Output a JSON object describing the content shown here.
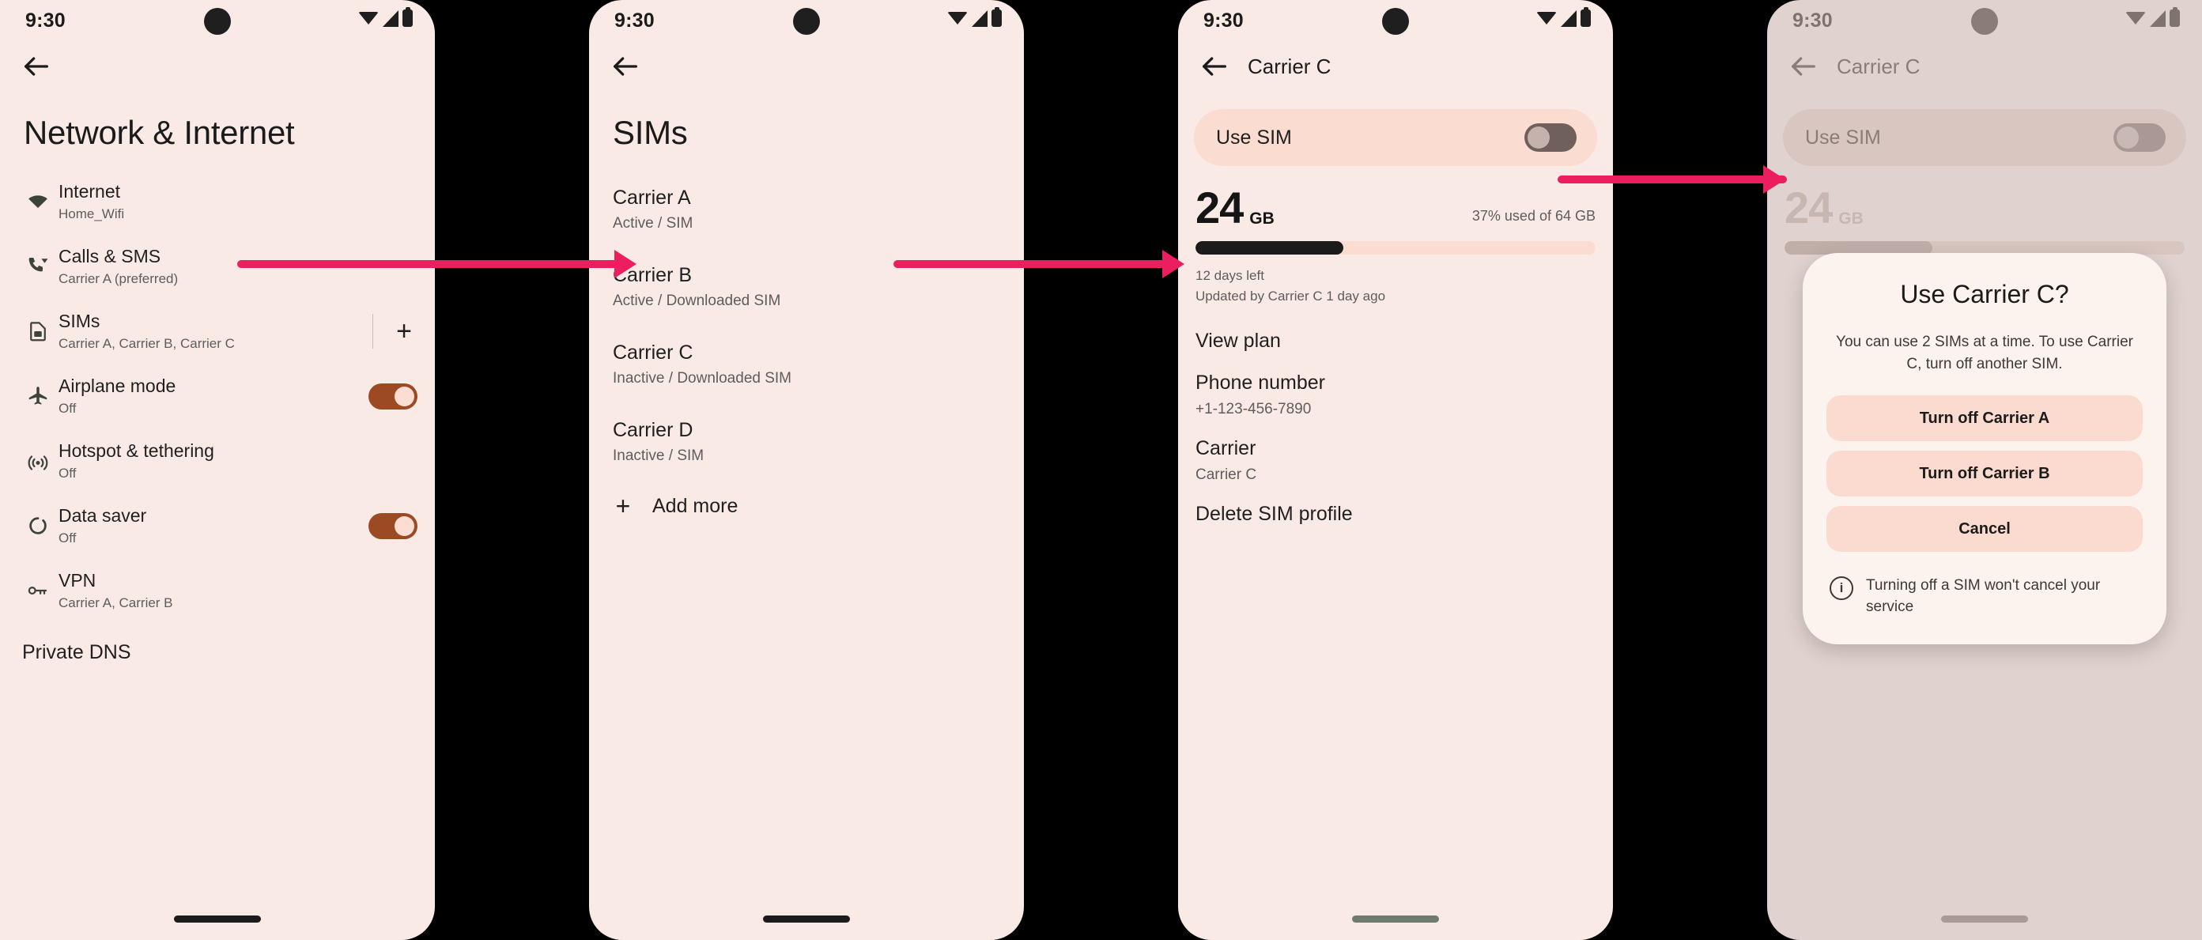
{
  "status_bar": {
    "time": "9:30",
    "icons": [
      "wifi-icon",
      "cellular-signal-icon",
      "battery-icon"
    ]
  },
  "panel1": {
    "title": "Network & Internet",
    "rows": [
      {
        "icon": "wifi-icon",
        "title": "Internet",
        "subtitle": "Home_Wifi",
        "control": "none"
      },
      {
        "icon": "phone-wifi-icon",
        "title": "Calls & SMS",
        "subtitle": "Carrier A (preferred)",
        "control": "none"
      },
      {
        "icon": "sim-card-icon",
        "title": "SIMs",
        "subtitle": "Carrier A, Carrier B, Carrier C",
        "control": "plus"
      },
      {
        "icon": "airplane-icon",
        "title": "Airplane mode",
        "subtitle": "Off",
        "control": "toggle"
      },
      {
        "icon": "hotspot-icon",
        "title": "Hotspot & tethering",
        "subtitle": "Off",
        "control": "none"
      },
      {
        "icon": "data-saver-icon",
        "title": "Data saver",
        "subtitle": "Off",
        "control": "toggle"
      },
      {
        "icon": "vpn-key-icon",
        "title": "VPN",
        "subtitle": "Carrier A, Carrier B",
        "control": "none"
      }
    ],
    "partial_row": "Private DNS",
    "add_label": "+"
  },
  "panel2": {
    "title": "SIMs",
    "sims": [
      {
        "name": "Carrier A",
        "status": "Active / SIM"
      },
      {
        "name": "Carrier B",
        "status": "Active / Downloaded SIM"
      },
      {
        "name": "Carrier C",
        "status": "Inactive / Downloaded SIM"
      },
      {
        "name": "Carrier D",
        "status": "Inactive / SIM"
      }
    ],
    "add_more": {
      "plus": "+",
      "label": "Add more"
    }
  },
  "panel3": {
    "appbar_title": "Carrier C",
    "use_sim": {
      "label": "Use SIM",
      "state": "off"
    },
    "usage": {
      "amount": "24",
      "unit": "GB",
      "percent_text": "37% used of 64 GB",
      "percent_value": 37,
      "days_left": "12 days left",
      "updated": "Updated by Carrier C 1 day ago"
    },
    "details": [
      {
        "title": "View plan",
        "value": ""
      },
      {
        "title": "Phone number",
        "value": "+1-123-456-7890"
      },
      {
        "title": "Carrier",
        "value": "Carrier C"
      },
      {
        "title": "Delete SIM profile",
        "value": ""
      }
    ]
  },
  "panel4": {
    "appbar_title": "Carrier C",
    "use_sim": {
      "label": "Use SIM",
      "state": "off"
    },
    "usage": {
      "amount": "24",
      "unit": "GB"
    },
    "dialog": {
      "title": "Use Carrier C?",
      "body": "You can use 2 SIMs at a time. To use Carrier C, turn off another SIM.",
      "buttons": [
        "Turn off Carrier A",
        "Turn off Carrier B",
        "Cancel"
      ],
      "note": "Turning off a SIM won't cancel your service",
      "note_icon": "info-icon"
    }
  },
  "colors": {
    "accent_arrow": "#ED1E5F",
    "surface": "#FAEAE6",
    "surface_dim": "#E0D2CE",
    "toggle_on": "#9B4A23",
    "card": "#FBDCD0"
  }
}
